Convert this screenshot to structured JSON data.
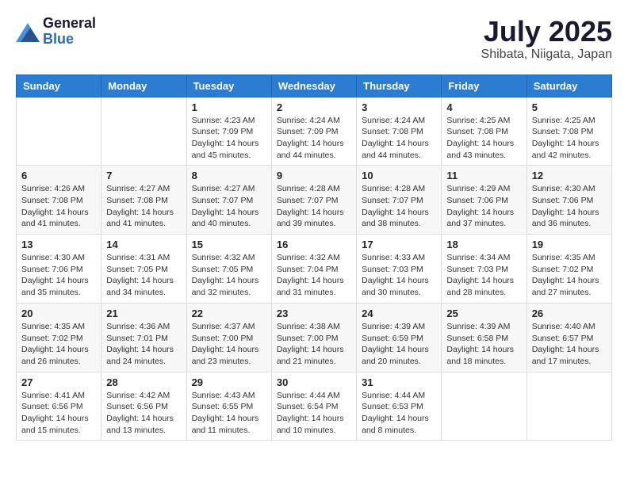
{
  "header": {
    "logo_general": "General",
    "logo_blue": "Blue",
    "month_year": "July 2025",
    "location": "Shibata, Niigata, Japan"
  },
  "weekdays": [
    "Sunday",
    "Monday",
    "Tuesday",
    "Wednesday",
    "Thursday",
    "Friday",
    "Saturday"
  ],
  "weeks": [
    [
      {
        "day": "",
        "info": ""
      },
      {
        "day": "",
        "info": ""
      },
      {
        "day": "1",
        "info": "Sunrise: 4:23 AM\nSunset: 7:09 PM\nDaylight: 14 hours and 45 minutes."
      },
      {
        "day": "2",
        "info": "Sunrise: 4:24 AM\nSunset: 7:09 PM\nDaylight: 14 hours and 44 minutes."
      },
      {
        "day": "3",
        "info": "Sunrise: 4:24 AM\nSunset: 7:08 PM\nDaylight: 14 hours and 44 minutes."
      },
      {
        "day": "4",
        "info": "Sunrise: 4:25 AM\nSunset: 7:08 PM\nDaylight: 14 hours and 43 minutes."
      },
      {
        "day": "5",
        "info": "Sunrise: 4:25 AM\nSunset: 7:08 PM\nDaylight: 14 hours and 42 minutes."
      }
    ],
    [
      {
        "day": "6",
        "info": "Sunrise: 4:26 AM\nSunset: 7:08 PM\nDaylight: 14 hours and 41 minutes."
      },
      {
        "day": "7",
        "info": "Sunrise: 4:27 AM\nSunset: 7:08 PM\nDaylight: 14 hours and 41 minutes."
      },
      {
        "day": "8",
        "info": "Sunrise: 4:27 AM\nSunset: 7:07 PM\nDaylight: 14 hours and 40 minutes."
      },
      {
        "day": "9",
        "info": "Sunrise: 4:28 AM\nSunset: 7:07 PM\nDaylight: 14 hours and 39 minutes."
      },
      {
        "day": "10",
        "info": "Sunrise: 4:28 AM\nSunset: 7:07 PM\nDaylight: 14 hours and 38 minutes."
      },
      {
        "day": "11",
        "info": "Sunrise: 4:29 AM\nSunset: 7:06 PM\nDaylight: 14 hours and 37 minutes."
      },
      {
        "day": "12",
        "info": "Sunrise: 4:30 AM\nSunset: 7:06 PM\nDaylight: 14 hours and 36 minutes."
      }
    ],
    [
      {
        "day": "13",
        "info": "Sunrise: 4:30 AM\nSunset: 7:06 PM\nDaylight: 14 hours and 35 minutes."
      },
      {
        "day": "14",
        "info": "Sunrise: 4:31 AM\nSunset: 7:05 PM\nDaylight: 14 hours and 34 minutes."
      },
      {
        "day": "15",
        "info": "Sunrise: 4:32 AM\nSunset: 7:05 PM\nDaylight: 14 hours and 32 minutes."
      },
      {
        "day": "16",
        "info": "Sunrise: 4:32 AM\nSunset: 7:04 PM\nDaylight: 14 hours and 31 minutes."
      },
      {
        "day": "17",
        "info": "Sunrise: 4:33 AM\nSunset: 7:03 PM\nDaylight: 14 hours and 30 minutes."
      },
      {
        "day": "18",
        "info": "Sunrise: 4:34 AM\nSunset: 7:03 PM\nDaylight: 14 hours and 28 minutes."
      },
      {
        "day": "19",
        "info": "Sunrise: 4:35 AM\nSunset: 7:02 PM\nDaylight: 14 hours and 27 minutes."
      }
    ],
    [
      {
        "day": "20",
        "info": "Sunrise: 4:35 AM\nSunset: 7:02 PM\nDaylight: 14 hours and 26 minutes."
      },
      {
        "day": "21",
        "info": "Sunrise: 4:36 AM\nSunset: 7:01 PM\nDaylight: 14 hours and 24 minutes."
      },
      {
        "day": "22",
        "info": "Sunrise: 4:37 AM\nSunset: 7:00 PM\nDaylight: 14 hours and 23 minutes."
      },
      {
        "day": "23",
        "info": "Sunrise: 4:38 AM\nSunset: 7:00 PM\nDaylight: 14 hours and 21 minutes."
      },
      {
        "day": "24",
        "info": "Sunrise: 4:39 AM\nSunset: 6:59 PM\nDaylight: 14 hours and 20 minutes."
      },
      {
        "day": "25",
        "info": "Sunrise: 4:39 AM\nSunset: 6:58 PM\nDaylight: 14 hours and 18 minutes."
      },
      {
        "day": "26",
        "info": "Sunrise: 4:40 AM\nSunset: 6:57 PM\nDaylight: 14 hours and 17 minutes."
      }
    ],
    [
      {
        "day": "27",
        "info": "Sunrise: 4:41 AM\nSunset: 6:56 PM\nDaylight: 14 hours and 15 minutes."
      },
      {
        "day": "28",
        "info": "Sunrise: 4:42 AM\nSunset: 6:56 PM\nDaylight: 14 hours and 13 minutes."
      },
      {
        "day": "29",
        "info": "Sunrise: 4:43 AM\nSunset: 6:55 PM\nDaylight: 14 hours and 11 minutes."
      },
      {
        "day": "30",
        "info": "Sunrise: 4:44 AM\nSunset: 6:54 PM\nDaylight: 14 hours and 10 minutes."
      },
      {
        "day": "31",
        "info": "Sunrise: 4:44 AM\nSunset: 6:53 PM\nDaylight: 14 hours and 8 minutes."
      },
      {
        "day": "",
        "info": ""
      },
      {
        "day": "",
        "info": ""
      }
    ]
  ]
}
